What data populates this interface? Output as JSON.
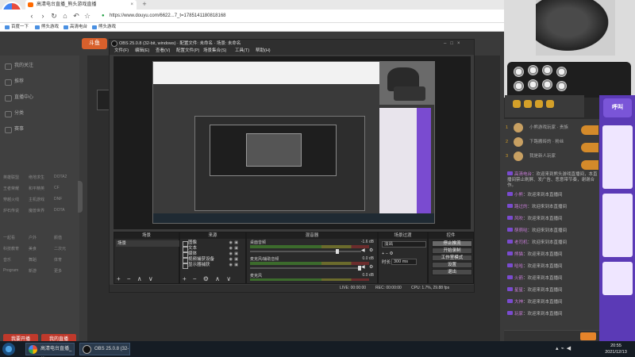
{
  "browser": {
    "logo_label": "双核浏览器",
    "tab_title": "高清电台直播_熊头游戏直播",
    "address": "https://www.douyu.com/6622...7_t=1785141180818168",
    "address_scheme": "https://",
    "bookmarks": [
      "百度一下",
      "熊头游戏",
      "高清电台",
      "熊头游戏"
    ]
  },
  "douyu": {
    "logo": "斗鱼",
    "sidebar": {
      "items": [
        "我的关注",
        "推荐",
        "直播中心",
        "分类",
        "赛事"
      ],
      "grid_rows": [
        [
          "英雄联盟",
          "绝地求生",
          "DOTA2"
        ],
        [
          "王者荣耀",
          "和平精英",
          "CF"
        ],
        [
          "穿越火线",
          "主机游戏",
          "DNF"
        ],
        [
          "炉石传说",
          "魔兽世界",
          "DOTA"
        ],
        [
          "一起看",
          "户外",
          "颜值"
        ],
        [
          "科技教育",
          "美食",
          "二次元"
        ],
        [
          "音乐",
          "舞蹈",
          "体育"
        ],
        [
          "Program",
          "新游",
          "更多"
        ]
      ],
      "footer_buttons": [
        "我要开播",
        "我的直播"
      ]
    }
  },
  "obs": {
    "title": "OBS 25.0.8 (32-bit, windows) · 配置文件: 未命名 · 场景: 未命名",
    "menu": [
      "文件(F)",
      "编辑(E)",
      "查看(V)",
      "配置文件(P)",
      "场景集合(S)",
      "工具(T)",
      "帮助(H)"
    ],
    "docks": {
      "scenes": {
        "header": "场景",
        "items": [
          "场景"
        ],
        "footer": "+ − ∧ ∨"
      },
      "sources": {
        "header": "来源",
        "items": [
          "图像",
          "文本",
          "媒体",
          "视频捕获设备",
          "显示器捕获"
        ],
        "footer": "+ − ⚙ ∧ ∨"
      },
      "mixer": {
        "header": "混音器",
        "channels": [
          {
            "name": "桌面音频",
            "db": "-1.6 dB"
          },
          {
            "name": "麦克风/辅助音频",
            "db": "0.0 dB"
          },
          {
            "name": "麦克风",
            "db": "0.0 dB"
          }
        ]
      },
      "transitions": {
        "header": "场景过渡",
        "type": "淡出",
        "duration_label": "时长",
        "duration_value": "300 ms"
      },
      "controls": {
        "header": "控件",
        "buttons": [
          "停止推流",
          "开始录制",
          "工作室模式",
          "设置",
          "退出"
        ]
      }
    },
    "status": {
      "live": "LIVE: 00:00:00",
      "rec": "REC: 00:00:00",
      "cpu": "CPU: 1.7%, 29.88 fps"
    }
  },
  "room": {
    "fans": [
      {
        "rank": "1",
        "name": "小熊游戏玩家 · 贵族"
      },
      {
        "rank": "2",
        "name": "下路搬砖的 · 粉丝"
      },
      {
        "rank": "3",
        "name": "我是新人玩家"
      }
    ],
    "chat": [
      {
        "name": "高清电台",
        "text": "欢迎来到熊头游戏直播间，本直播间禁止刷屏、发广告、恶意带节奏，谢谢合作。"
      },
      {
        "name": "小熊",
        "text": "欢迎来到本直播间"
      },
      {
        "name": "路过的",
        "text": "欢迎来到本直播间"
      },
      {
        "name": "风吹",
        "text": "欢迎来到本直播间"
      },
      {
        "name": "萌萌哒",
        "text": "欢迎来到本直播间"
      },
      {
        "name": "老司机",
        "text": "欢迎来到本直播间"
      },
      {
        "name": "熊猫",
        "text": "欢迎来到本直播间"
      },
      {
        "name": "哈哈",
        "text": "欢迎来到本直播间"
      },
      {
        "name": "火箭",
        "text": "欢迎来到本直播间"
      },
      {
        "name": "星星",
        "text": "欢迎来到本直播间"
      },
      {
        "name": "大神",
        "text": "欢迎来到本直播间"
      },
      {
        "name": "玩家",
        "text": "欢迎来到本直播间"
      }
    ],
    "promo_title": "呼叫"
  },
  "taskbar": {
    "items": [
      "高清电台直播_熊...",
      "OBS 25.0.8 (32-bit..."
    ],
    "time": "20:55",
    "date": "2021/12/13"
  }
}
